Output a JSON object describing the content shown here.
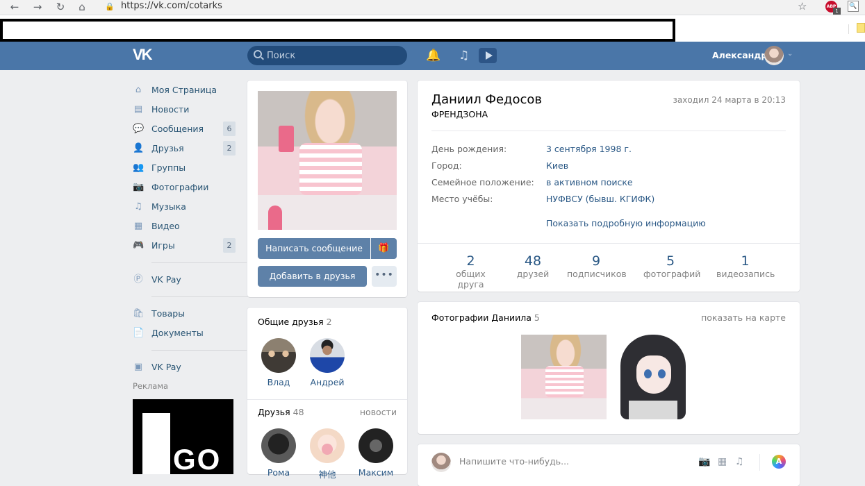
{
  "browser": {
    "back": "←",
    "forward": "→",
    "reload": "↻",
    "home": "⌂",
    "lock_icon": "🔒",
    "url": "https://vk.com/cotarks",
    "star": "☆",
    "abp_label": "ABP",
    "abp_badge": "1",
    "search_ext": "🔍"
  },
  "header": {
    "logo": "VK",
    "search_placeholder": "Поиск",
    "bell_icon": "🔔",
    "music_icon": "♫",
    "user_name": "Александр",
    "chevron": "⌄"
  },
  "sidebar": {
    "items": [
      {
        "label": "Моя Страница",
        "icon": "⌂",
        "count": ""
      },
      {
        "label": "Новости",
        "icon": "▤",
        "count": ""
      },
      {
        "label": "Сообщения",
        "icon": "💬",
        "count": "6"
      },
      {
        "label": "Друзья",
        "icon": "👤",
        "count": "2"
      },
      {
        "label": "Группы",
        "icon": "👥",
        "count": ""
      },
      {
        "label": "Фотографии",
        "icon": "📷",
        "count": ""
      },
      {
        "label": "Музыка",
        "icon": "♫",
        "count": ""
      },
      {
        "label": "Видео",
        "icon": "▦",
        "count": ""
      },
      {
        "label": "Игры",
        "icon": "🎮",
        "count": "2"
      }
    ],
    "vkpay_label": "VK Pay",
    "vkpay_icon": "Ⓟ",
    "goods_label": "Товары",
    "goods_icon": "🛍",
    "docs_label": "Документы",
    "docs_icon": "📄",
    "apps_label": "VK Pay",
    "apps_icon": "▣",
    "ads_label": "Реклама",
    "ad_text": "GO"
  },
  "profile": {
    "write_button": "Написать сообщение",
    "gift_icon": "🎁",
    "add_button": "Добавить в друзья",
    "more_icon": "•••"
  },
  "mutual": {
    "title": "Общие друзья",
    "count": "2",
    "friends": [
      {
        "name": "Влад"
      },
      {
        "name": "Андрей"
      }
    ]
  },
  "friends": {
    "title": "Друзья",
    "count": "48",
    "link": "новости",
    "list": [
      {
        "name": "Рома"
      },
      {
        "name": "神他"
      },
      {
        "name": "Максим"
      }
    ]
  },
  "info": {
    "name": "Даниил Федосов",
    "status": "ФРЕНДЗОНА",
    "last_seen": "заходил 24 марта в 20:13",
    "rows": [
      {
        "label": "День рождения:",
        "value": "3 сентября 1998 г."
      },
      {
        "label": "Город:",
        "value": "Киев"
      },
      {
        "label": "Семейное положение:",
        "value": "в активном поиске"
      },
      {
        "label": "Место учёбы:",
        "value": "НУФВСУ (бывш. КГИФК)"
      }
    ],
    "show_more": "Показать подробную информацию",
    "counters": [
      {
        "num": "2",
        "label": "общих друга"
      },
      {
        "num": "48",
        "label": "друзей"
      },
      {
        "num": "9",
        "label": "подписчиков"
      },
      {
        "num": "5",
        "label": "фотографий"
      },
      {
        "num": "1",
        "label": "видеозапись"
      }
    ]
  },
  "photos": {
    "title": "Фотографии Даниила",
    "count": "5",
    "map_link": "показать на карте"
  },
  "post": {
    "placeholder": "Напишите что-нибудь...",
    "camera_icon": "📷",
    "video_icon": "▦",
    "music_icon": "♫",
    "a_label": "A"
  }
}
